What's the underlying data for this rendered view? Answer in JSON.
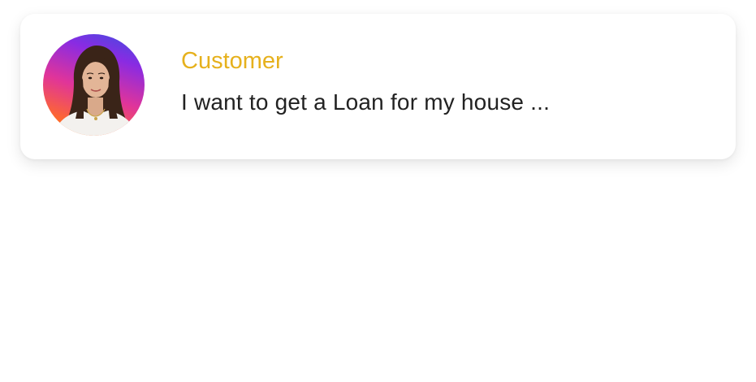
{
  "card": {
    "sender": "Customer",
    "message": "I want to get a Loan for my house ...",
    "avatar_icon": "customer-avatar-photo"
  },
  "colors": {
    "sender_name": "#e6b11d",
    "message_text": "#222222",
    "card_background": "#ffffff",
    "avatar_gradient": [
      "#3b4fe0",
      "#8a2be2",
      "#e0349a",
      "#ff6a2a"
    ]
  }
}
